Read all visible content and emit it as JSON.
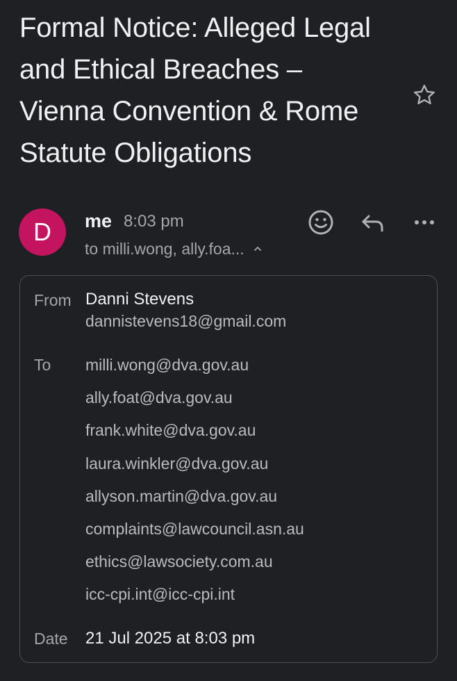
{
  "email": {
    "subject": "Formal Notice: Alleged Legal and Ethical Breaches – Vienna Convention & Rome Statute Obligations",
    "sender": {
      "avatar_initial": "D",
      "avatar_color": "#c4135f",
      "display": "me",
      "time": "8:03 pm",
      "recipients_summary": "to milli.wong, ally.foa..."
    },
    "actions": {
      "star_icon": "star-outline-icon",
      "react_icon": "emoji-icon",
      "reply_icon": "reply-icon",
      "more_icon": "more-horizontal-icon"
    },
    "details": {
      "from_label": "From",
      "from_name": "Danni Stevens",
      "from_email": "dannistevens18@gmail.com",
      "to_label": "To",
      "to": [
        "milli.wong@dva.gov.au",
        "ally.foat@dva.gov.au",
        "frank.white@dva.gov.au",
        "laura.winkler@dva.gov.au",
        "allyson.martin@dva.gov.au",
        "complaints@lawcouncil.asn.au",
        "ethics@lawsociety.com.au",
        "icc-cpi.int@icc-cpi.int"
      ],
      "date_label": "Date",
      "date_value": "21 Jul 2025 at 8:03 pm"
    }
  }
}
